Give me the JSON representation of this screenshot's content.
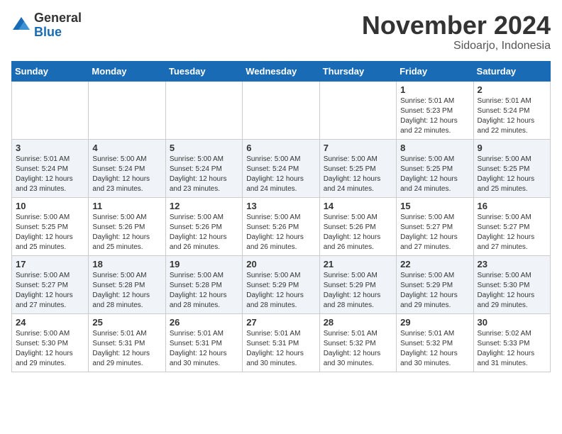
{
  "header": {
    "logo_general": "General",
    "logo_blue": "Blue",
    "month_title": "November 2024",
    "location": "Sidoarjo, Indonesia"
  },
  "weekdays": [
    "Sunday",
    "Monday",
    "Tuesday",
    "Wednesday",
    "Thursday",
    "Friday",
    "Saturday"
  ],
  "weeks": [
    [
      {
        "day": "",
        "info": ""
      },
      {
        "day": "",
        "info": ""
      },
      {
        "day": "",
        "info": ""
      },
      {
        "day": "",
        "info": ""
      },
      {
        "day": "",
        "info": ""
      },
      {
        "day": "1",
        "info": "Sunrise: 5:01 AM\nSunset: 5:23 PM\nDaylight: 12 hours\nand 22 minutes."
      },
      {
        "day": "2",
        "info": "Sunrise: 5:01 AM\nSunset: 5:24 PM\nDaylight: 12 hours\nand 22 minutes."
      }
    ],
    [
      {
        "day": "3",
        "info": "Sunrise: 5:01 AM\nSunset: 5:24 PM\nDaylight: 12 hours\nand 23 minutes."
      },
      {
        "day": "4",
        "info": "Sunrise: 5:00 AM\nSunset: 5:24 PM\nDaylight: 12 hours\nand 23 minutes."
      },
      {
        "day": "5",
        "info": "Sunrise: 5:00 AM\nSunset: 5:24 PM\nDaylight: 12 hours\nand 23 minutes."
      },
      {
        "day": "6",
        "info": "Sunrise: 5:00 AM\nSunset: 5:24 PM\nDaylight: 12 hours\nand 24 minutes."
      },
      {
        "day": "7",
        "info": "Sunrise: 5:00 AM\nSunset: 5:25 PM\nDaylight: 12 hours\nand 24 minutes."
      },
      {
        "day": "8",
        "info": "Sunrise: 5:00 AM\nSunset: 5:25 PM\nDaylight: 12 hours\nand 24 minutes."
      },
      {
        "day": "9",
        "info": "Sunrise: 5:00 AM\nSunset: 5:25 PM\nDaylight: 12 hours\nand 25 minutes."
      }
    ],
    [
      {
        "day": "10",
        "info": "Sunrise: 5:00 AM\nSunset: 5:25 PM\nDaylight: 12 hours\nand 25 minutes."
      },
      {
        "day": "11",
        "info": "Sunrise: 5:00 AM\nSunset: 5:26 PM\nDaylight: 12 hours\nand 25 minutes."
      },
      {
        "day": "12",
        "info": "Sunrise: 5:00 AM\nSunset: 5:26 PM\nDaylight: 12 hours\nand 26 minutes."
      },
      {
        "day": "13",
        "info": "Sunrise: 5:00 AM\nSunset: 5:26 PM\nDaylight: 12 hours\nand 26 minutes."
      },
      {
        "day": "14",
        "info": "Sunrise: 5:00 AM\nSunset: 5:26 PM\nDaylight: 12 hours\nand 26 minutes."
      },
      {
        "day": "15",
        "info": "Sunrise: 5:00 AM\nSunset: 5:27 PM\nDaylight: 12 hours\nand 27 minutes."
      },
      {
        "day": "16",
        "info": "Sunrise: 5:00 AM\nSunset: 5:27 PM\nDaylight: 12 hours\nand 27 minutes."
      }
    ],
    [
      {
        "day": "17",
        "info": "Sunrise: 5:00 AM\nSunset: 5:27 PM\nDaylight: 12 hours\nand 27 minutes."
      },
      {
        "day": "18",
        "info": "Sunrise: 5:00 AM\nSunset: 5:28 PM\nDaylight: 12 hours\nand 28 minutes."
      },
      {
        "day": "19",
        "info": "Sunrise: 5:00 AM\nSunset: 5:28 PM\nDaylight: 12 hours\nand 28 minutes."
      },
      {
        "day": "20",
        "info": "Sunrise: 5:00 AM\nSunset: 5:29 PM\nDaylight: 12 hours\nand 28 minutes."
      },
      {
        "day": "21",
        "info": "Sunrise: 5:00 AM\nSunset: 5:29 PM\nDaylight: 12 hours\nand 28 minutes."
      },
      {
        "day": "22",
        "info": "Sunrise: 5:00 AM\nSunset: 5:29 PM\nDaylight: 12 hours\nand 29 minutes."
      },
      {
        "day": "23",
        "info": "Sunrise: 5:00 AM\nSunset: 5:30 PM\nDaylight: 12 hours\nand 29 minutes."
      }
    ],
    [
      {
        "day": "24",
        "info": "Sunrise: 5:00 AM\nSunset: 5:30 PM\nDaylight: 12 hours\nand 29 minutes."
      },
      {
        "day": "25",
        "info": "Sunrise: 5:01 AM\nSunset: 5:31 PM\nDaylight: 12 hours\nand 29 minutes."
      },
      {
        "day": "26",
        "info": "Sunrise: 5:01 AM\nSunset: 5:31 PM\nDaylight: 12 hours\nand 30 minutes."
      },
      {
        "day": "27",
        "info": "Sunrise: 5:01 AM\nSunset: 5:31 PM\nDaylight: 12 hours\nand 30 minutes."
      },
      {
        "day": "28",
        "info": "Sunrise: 5:01 AM\nSunset: 5:32 PM\nDaylight: 12 hours\nand 30 minutes."
      },
      {
        "day": "29",
        "info": "Sunrise: 5:01 AM\nSunset: 5:32 PM\nDaylight: 12 hours\nand 30 minutes."
      },
      {
        "day": "30",
        "info": "Sunrise: 5:02 AM\nSunset: 5:33 PM\nDaylight: 12 hours\nand 31 minutes."
      }
    ]
  ]
}
